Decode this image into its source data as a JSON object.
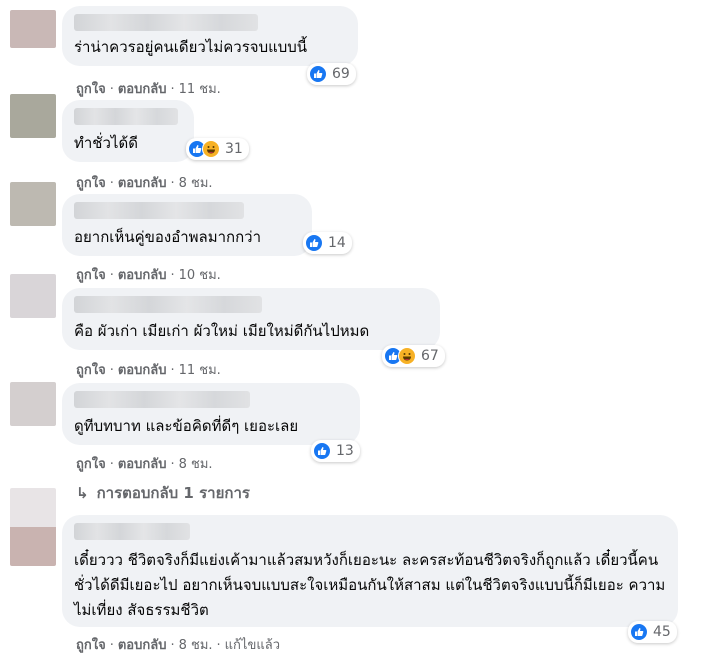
{
  "comments": [
    {
      "text": "ร่าน่าควรอยู่คนเดียวไม่ควรจบแบบนี้",
      "reaction_count": "69",
      "reaction_icons": [
        "like-icon"
      ],
      "like_label": "ถูกใจ",
      "reply_label": "ตอบกลับ",
      "separator": "·",
      "time": "11 ชม."
    },
    {
      "text": "ทำชั่วได้ดี",
      "reaction_count": "31",
      "reaction_icons": [
        "like-icon",
        "haha-icon"
      ],
      "like_label": "ถูกใจ",
      "reply_label": "ตอบกลับ",
      "separator": "·",
      "time": "8 ชม."
    },
    {
      "text": "อยากเห็นคู่ของอำพลมากกว่า",
      "reaction_count": "14",
      "reaction_icons": [
        "like-icon"
      ],
      "like_label": "ถูกใจ",
      "reply_label": "ตอบกลับ",
      "separator": "·",
      "time": "10 ชม."
    },
    {
      "text": "คือ ผัวเก่า เมียเก่า ผัวใหม่ เมียใหม่ดีกันไปหมด",
      "reaction_count": "67",
      "reaction_icons": [
        "like-icon",
        "haha-icon"
      ],
      "like_label": "ถูกใจ",
      "reply_label": "ตอบกลับ",
      "separator": "·",
      "time": "11 ชม."
    },
    {
      "text": "ดูทีบทบาท และข้อคิดที่ดีๆ เยอะเลย",
      "reaction_count": "13",
      "reaction_icons": [
        "like-icon"
      ],
      "like_label": "ถูกใจ",
      "reply_label": "ตอบกลับ",
      "separator": "·",
      "time": "8 ชม."
    },
    {
      "text": "เดี๋ยววว ชีวิตจริงก็มีแย่งเค้ามาแล้วสมหวังก็เยอะนะ ละครสะท้อนชีวิตจริงก็ถูกแล้ว เดี๋ยวนี้คนชั่วได้ดีมีเยอะไป อยากเห็นจบแบบสะใจเหมือนกันให้สาสม แต่ในชีวิตจริงแบบนี้ก็มีเยอะ ความไม่เที่ยง สัจธรรมชีวิต",
      "reaction_count": "45",
      "reaction_icons": [
        "like-icon"
      ],
      "like_label": "ถูกใจ",
      "reply_label": "ตอบกลับ",
      "separator": "·",
      "time": "8 ชม.",
      "edited_label": "แก้ไขแล้ว"
    }
  ],
  "replies_link": {
    "arrow": "↳",
    "label": "การตอบกลับ 1 รายการ"
  },
  "colors": {
    "bubble": "#f0f2f5",
    "meta_text": "#65676b",
    "like_blue": "#1877f2",
    "haha_yellow": "#f7b125"
  }
}
